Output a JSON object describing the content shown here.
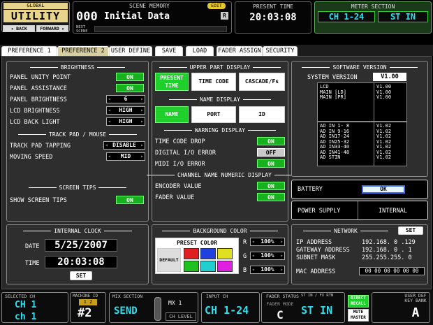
{
  "header": {
    "global_label": "GLOBAL",
    "utility_label": "UTILITY",
    "back_label": "◂ BACK",
    "forward_label": "FORWARD ▸",
    "scene_memory_label": "SCENE MEMORY",
    "edit_badge": "EDIT",
    "scene_number": "000",
    "scene_name": "Initial Data",
    "r_badge": "R",
    "next_scene_label": "NEXT SCENE",
    "present_time_label": "PRESENT TIME",
    "present_time": "20:03:08",
    "meter_section_label": "METER SECTION",
    "meter_ch": "CH 1-24",
    "meter_st": "ST IN"
  },
  "tabs": [
    {
      "label": "PREFERENCE 1"
    },
    {
      "label": "PREFERENCE 2"
    },
    {
      "label": "USER DEFINE"
    },
    {
      "label": "SAVE"
    },
    {
      "label": "LOAD"
    },
    {
      "label": "FADER ASSIGN"
    },
    {
      "label": "SECURITY"
    }
  ],
  "brightness": {
    "title": "BRIGHTNESS",
    "rows": [
      {
        "label": "PANEL UNITY POINT",
        "value": "ON"
      },
      {
        "label": "PANEL ASSISTANCE",
        "value": "ON"
      },
      {
        "label": "PANEL BRIGHTNESS",
        "value": "6"
      },
      {
        "label": "LCD BRIGHTNESS",
        "value": "HIGH"
      },
      {
        "label": "LCD BACK LIGHT",
        "value": "HIGH"
      }
    ]
  },
  "trackpad": {
    "title": "TRACK PAD / MOUSE",
    "rows": [
      {
        "label": "TRACK PAD TAPPING",
        "value": "DISABLE"
      },
      {
        "label": "MOVING SPEED",
        "value": "MID"
      }
    ]
  },
  "screen_tips": {
    "title": "SCREEN TIPS",
    "label": "SHOW SCREEN TIPS",
    "value": "ON"
  },
  "upper_display": {
    "title": "UPPER PART DISPLAY",
    "opts": [
      "PRESENT TIME",
      "TIME CODE",
      "CASCADE/Fs"
    ]
  },
  "name_display": {
    "title": "NAME DISPLAY",
    "opts": [
      "NAME",
      "PORT",
      "ID"
    ]
  },
  "warning": {
    "title": "WARNING DISPLAY",
    "rows": [
      {
        "label": "TIME CODE DROP",
        "value": "ON"
      },
      {
        "label": "DIGITAL I/O ERROR",
        "value": "OFF"
      },
      {
        "label": "MIDI I/O ERROR",
        "value": "ON"
      }
    ]
  },
  "channel_numeric": {
    "title": "CHANNEL NAME NUMERIC DISPLAY",
    "rows": [
      {
        "label": "ENCODER VALUE",
        "value": "ON"
      },
      {
        "label": "FADER VALUE",
        "value": "ON"
      }
    ]
  },
  "software": {
    "title": "SOFTWARE VERSION",
    "system_label": "SYSTEM VERSION",
    "system_value": "V1.00",
    "block1_labels": "LCD\nMAIN [LD]\nMAIN [PR]",
    "block1_values": "V1.00\nV1.00\nV1.00",
    "block2_labels": "AD IN 1- 8\nAD IN 9-16\nAD IN17-24\nAD IN25-32\nAD IN33-40\nAD IN41-48\nAD STIN",
    "block2_values": "V1.02\nV1.02\nV1.02\nV1.02\nV1.02\nV1.02\nV1.02"
  },
  "battery": {
    "label": "BATTERY",
    "value": "OK"
  },
  "power": {
    "label": "POWER SUPPLY",
    "value": "INTERNAL"
  },
  "clock": {
    "title": "INTERNAL CLOCK",
    "date_label": "DATE",
    "date": "5/25/2007",
    "time_label": "TIME",
    "time": "20:03:08",
    "set_label": "SET"
  },
  "bg_color": {
    "title": "BACKGROUND COLOR",
    "preset_label": "PRESET COLOR",
    "default_label": "DEFAULT",
    "swatches": [
      "#e02020",
      "#2040e0",
      "#e0e020",
      "#20c020",
      "#20d0d0",
      "#e020e0"
    ],
    "r_label": "R",
    "r_value": "100%",
    "g_label": "G",
    "g_value": "100%",
    "b_label": "B",
    "b_value": "100%"
  },
  "network": {
    "title": "NETWORK",
    "set_label": "SET",
    "rows": [
      {
        "label": "IP ADDRESS",
        "value": "192.168. 0 .129"
      },
      {
        "label": "GATEWAY ADDRESS",
        "value": "192.168. 0 . 1"
      },
      {
        "label": "SUBNET MASK",
        "value": "255.255.255. 0"
      },
      {
        "label": "MAC ADDRESS",
        "value": "00 00 00 00 00 00"
      }
    ]
  },
  "footer": {
    "selected_ch_label": "SELECTED CH",
    "selected_ch": "CH 1",
    "selected_ch_name": "ch 1",
    "machine_id_label": "MACHINE ID",
    "machine_id_badge": "1 2",
    "machine_id": "#2",
    "mix_section_label": "MIX SECTION",
    "mix_value": "SEND",
    "mx_label": "MX 1",
    "ch_level": "CH LEVEL",
    "input_ch_label": "INPUT CH",
    "input_ch": "CH 1-24",
    "fader_status_label": "FADER STATUS",
    "fader_mode_label": "FADER MODE",
    "fader_mode": "C",
    "stin_label": "ST IN / FX RTN",
    "stin_value": "ST IN",
    "direct_recall": "DIRECT RECALL",
    "mute_master": "MUTE MASTER",
    "user_def_label": "USER DEF KEY BANK",
    "user_def_value": "A"
  },
  "colors": {
    "accent_green": "#17b01e",
    "tab_active": "#d8cfa0",
    "lcd_cyan": "#2be0f0"
  }
}
